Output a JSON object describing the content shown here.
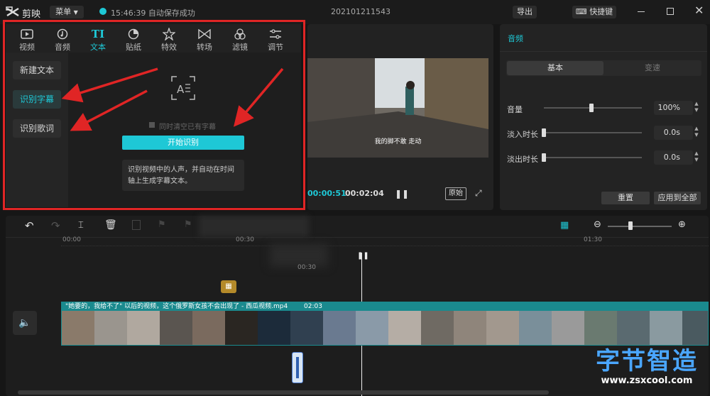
{
  "app": {
    "name": "剪映",
    "menu_label": "菜单",
    "autosave": "15:46:39 自动保存成功",
    "project_name": "202101211543",
    "export_label": "导出",
    "shortcut_label": "快捷键"
  },
  "toolbar": {
    "items": [
      {
        "label": "视频",
        "icon": "video-icon"
      },
      {
        "label": "音频",
        "icon": "audio-icon"
      },
      {
        "label": "文本",
        "icon": "text-icon",
        "active": true
      },
      {
        "label": "贴纸",
        "icon": "sticker-icon"
      },
      {
        "label": "特效",
        "icon": "effects-icon"
      },
      {
        "label": "转场",
        "icon": "transition-icon"
      },
      {
        "label": "滤镜",
        "icon": "filter-icon"
      },
      {
        "label": "调节",
        "icon": "adjust-icon"
      }
    ]
  },
  "text_panel": {
    "side_buttons": [
      "新建文本",
      "识别字幕",
      "识别歌词"
    ],
    "clear_checkbox": "同时清空已有字幕",
    "start_button": "开始识别",
    "description": "识别视频中的人声，并自动在时间轴上生成字幕文本。"
  },
  "player": {
    "subtitle": "我的脚不敢  走动",
    "current_time": "00:00:51",
    "total_time": "00:02:04",
    "ratio_label": "原始"
  },
  "audio_panel": {
    "title": "音频",
    "tabs": [
      "基本",
      "变速"
    ],
    "rows": [
      {
        "label": "音量",
        "value": "100%",
        "level": 0.5
      },
      {
        "label": "淡入时长",
        "value": "0.0s",
        "level": 0.0
      },
      {
        "label": "淡出时长",
        "value": "0.0s",
        "level": 0.0
      }
    ],
    "reset_label": "重置",
    "apply_all_label": "应用到全部"
  },
  "timeline": {
    "ruler": [
      "00:00",
      "00:30",
      "01:30"
    ],
    "playhead_time": "00:30",
    "clip_title": "\"她要的，我给不了\" 以后的视频，这个俄罗斯女孩不会出现了 - 西瓜视频.mp4",
    "clip_duration": "02:03",
    "zoom_level": 0.35
  },
  "watermark": {
    "text": "字节智造",
    "url": "www.zsxcool.com"
  },
  "colors": {
    "accent": "#1ec8d6",
    "red": "#e02525",
    "clip_header": "#1a8a8e"
  }
}
